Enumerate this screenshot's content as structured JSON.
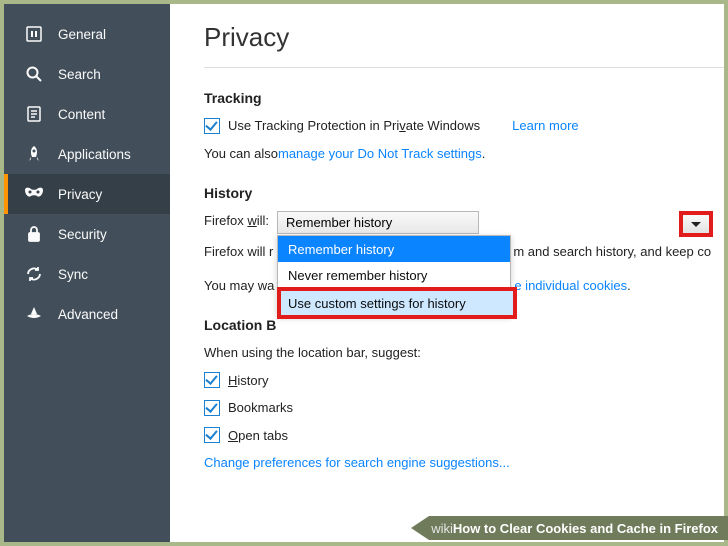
{
  "sidebar": {
    "items": [
      {
        "label": "General"
      },
      {
        "label": "Search"
      },
      {
        "label": "Content"
      },
      {
        "label": "Applications"
      },
      {
        "label": "Privacy"
      },
      {
        "label": "Security"
      },
      {
        "label": "Sync"
      },
      {
        "label": "Advanced"
      }
    ],
    "activeIndex": 4
  },
  "page": {
    "title": "Privacy",
    "tracking": {
      "heading": "Tracking",
      "checkbox_label_pre": "Use Tracking Protection in Pri",
      "checkbox_label_u": "v",
      "checkbox_label_post": "ate Windows",
      "learn_more": "Learn more",
      "dnt_pre": "You can also ",
      "dnt_link": "manage your Do Not Track settings",
      "dnt_post": "."
    },
    "history": {
      "heading": "History",
      "will_pre": "Firefox ",
      "will_u": "w",
      "will_post": "ill:",
      "selected": "Remember history",
      "options": [
        "Remember history",
        "Never remember history",
        "Use custom settings for history"
      ],
      "line2_pre": "Firefox will r",
      "line2_post": "m and search history, and keep co",
      "line3_pre": "You may wa",
      "line3_link": "e individual cookies",
      "line3_post": "."
    },
    "location": {
      "heading": "Location B",
      "intro": "When using the location bar, suggest:",
      "opt1_u": "H",
      "opt1_post": "istory",
      "opt2": "Bookmarks",
      "opt3_u": "O",
      "opt3_post": "pen tabs",
      "link": "Change preferences for search engine suggestions..."
    }
  },
  "caption": {
    "wiki": "wiki",
    "how": "How to Clear Cookies and Cache in Firefox"
  }
}
